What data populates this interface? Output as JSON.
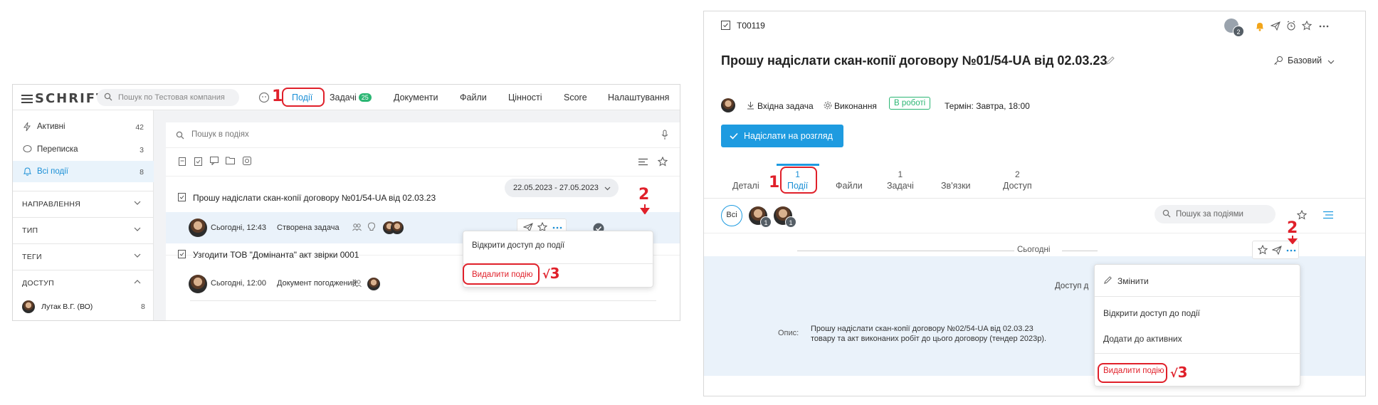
{
  "left": {
    "logo": "SCHRIFT",
    "search_placeholder": "Пошук по Тестовая компания",
    "nav": {
      "events": "Події",
      "tasks": "Задачі",
      "tasks_badge": "25",
      "documents": "Документи",
      "files": "Файли",
      "values": "Цінності",
      "score": "Score",
      "settings": "Налаштування"
    },
    "sidebar": {
      "items": [
        {
          "label": "Активні",
          "count": "42"
        },
        {
          "label": "Переписка",
          "count": "3"
        },
        {
          "label": "Всі події",
          "count": "8"
        }
      ],
      "sections": [
        "НАПРАВЛЕННЯ",
        "ТИП",
        "ТЕГИ",
        "ДОСТУП"
      ],
      "access_user": {
        "label": "Лутак В.Г. (ВО)",
        "count": "8"
      }
    },
    "main": {
      "search_placeholder": "Пошук в подіях",
      "date_range": "22.05.2023 - 27.05.2023",
      "events": [
        {
          "title": "Прошу надіслати скан-копії договору №01/54-UA від 02.03.23",
          "time": "Сьогодні, 12:43",
          "action": "Створена задача"
        },
        {
          "title": "Узгодити ТОВ \"Домінанта\" акт звірки 0001",
          "time": "Сьогодні, 12:00",
          "action": "Документ погоджений"
        }
      ],
      "menu": {
        "share": "Відкрити доступ до події",
        "delete": "Видалити подію"
      }
    },
    "markers": {
      "m1": "1",
      "m2": "2",
      "m3": "3"
    }
  },
  "right": {
    "task_id": "T00119",
    "participants_count": "2",
    "title": "Прошу надіслати скан-копії договору №01/54-UA від 02.03.23",
    "mode": "Базовий",
    "meta": {
      "incoming": "Вхідна задача",
      "execution": "Виконання",
      "status": "В роботі",
      "deadline": "Термін: Завтра, 18:00"
    },
    "send_button": "Надіслати на розгляд",
    "tabs": [
      {
        "label": "Деталі",
        "count": ""
      },
      {
        "label": "Події",
        "count": "1"
      },
      {
        "label": "Файли",
        "count": ""
      },
      {
        "label": "Задачі",
        "count": "1"
      },
      {
        "label": "Зв'язки",
        "count": ""
      },
      {
        "label": "Доступ",
        "count": "2"
      }
    ],
    "filter_all": "Всі",
    "avatar_badges": [
      "1",
      "1"
    ],
    "search_placeholder": "Пошук за подіями",
    "today": "Сьогодні",
    "access_partial": "Доступ д",
    "description_label": "Опис:",
    "description_line1": "Прошу надіслати скан-копії договору №02/54-UA від 02.03.23",
    "description_line2": "товару та акт виконаних робіт до цього договору (тендер 2023р).",
    "menu": {
      "edit": "Змінити",
      "share": "Відкрити доступ до події",
      "add_active": "Додати до активних",
      "delete": "Видалити подію"
    },
    "markers": {
      "m1": "1",
      "m2": "2",
      "m3": "3"
    }
  },
  "colors": {
    "accent": "#1e9be0",
    "marker": "#e0202a",
    "success": "#2bb673"
  }
}
